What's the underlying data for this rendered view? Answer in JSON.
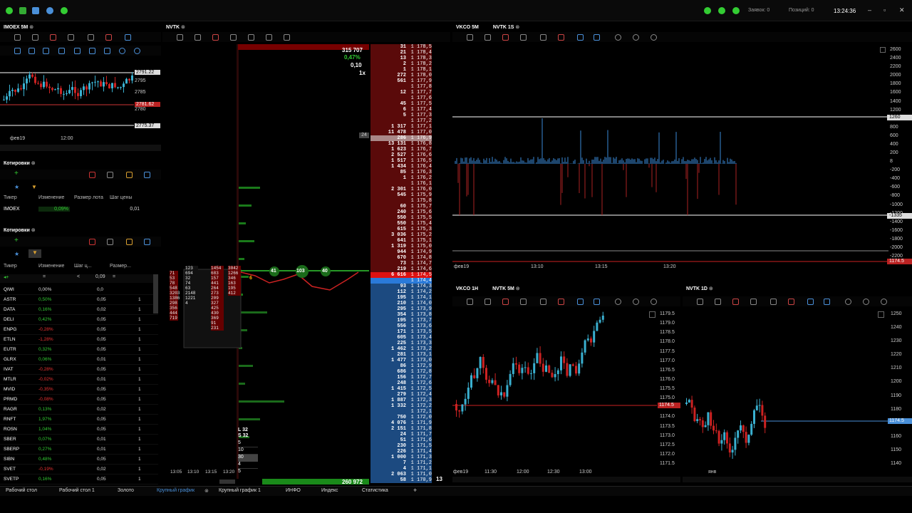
{
  "topbar": {
    "orders": "Заявок: 0",
    "positions": "Позиций: 0",
    "time": "13:24:36"
  },
  "imoex_chart": {
    "tab": "IMOEX 5M",
    "prices": [
      "2795",
      "2791.22",
      "2785",
      "2781.62",
      "2780",
      "2775.37"
    ],
    "xlabels": [
      "фев19",
      "12:00"
    ]
  },
  "quotes1": {
    "title": "Котировки",
    "headers": [
      "Тикер",
      "Изменение",
      "Размер лота",
      "Шаг цены"
    ],
    "row": {
      "ticker": "IMOEX",
      "change": "0,09%",
      "step": "0,01"
    }
  },
  "quotes2": {
    "title": "Котировки",
    "headers": [
      "Тикер",
      "Изменение",
      "Шаг ц...",
      "Размер..."
    ],
    "filter": {
      "change": "=",
      "step": "0,09",
      "lot": "="
    },
    "rows": [
      {
        "t": "QIWI",
        "c": "0,00%",
        "s": "0,0",
        "l": "",
        "col": "#ddd"
      },
      {
        "t": "ASTR",
        "c": "0,50%",
        "s": "0,05",
        "l": "1",
        "col": "#3c3"
      },
      {
        "t": "DATA",
        "c": "0,16%",
        "s": "0,02",
        "l": "1",
        "col": "#3c3"
      },
      {
        "t": "DELI",
        "c": "0,42%",
        "s": "0,05",
        "l": "1",
        "col": "#3c3"
      },
      {
        "t": "ENPG",
        "c": "-0,28%",
        "s": "0,05",
        "l": "1",
        "col": "#e33"
      },
      {
        "t": "ETLN",
        "c": "-1,28%",
        "s": "0,05",
        "l": "1",
        "col": "#e33"
      },
      {
        "t": "EUTR",
        "c": "0,32%",
        "s": "0,05",
        "l": "1",
        "col": "#3c3"
      },
      {
        "t": "GLRX",
        "c": "0,06%",
        "s": "0,01",
        "l": "1",
        "col": "#3c3"
      },
      {
        "t": "IVAT",
        "c": "-0,28%",
        "s": "0,05",
        "l": "1",
        "col": "#e33"
      },
      {
        "t": "MTLR",
        "c": "-0,02%",
        "s": "0,01",
        "l": "1",
        "col": "#e33"
      },
      {
        "t": "MVID",
        "c": "-0,35%",
        "s": "0,05",
        "l": "1",
        "col": "#e33"
      },
      {
        "t": "PRMD",
        "c": "-0,08%",
        "s": "0,05",
        "l": "1",
        "col": "#e33"
      },
      {
        "t": "RAGR",
        "c": "0,13%",
        "s": "0,02",
        "l": "1",
        "col": "#3c3"
      },
      {
        "t": "RNFT",
        "c": "1,97%",
        "s": "0,05",
        "l": "1",
        "col": "#3c3"
      },
      {
        "t": "ROSN",
        "c": "1,04%",
        "s": "0,05",
        "l": "1",
        "col": "#3c3"
      },
      {
        "t": "SBER",
        "c": "0,07%",
        "s": "0,01",
        "l": "1",
        "col": "#3c3"
      },
      {
        "t": "SBERP",
        "c": "0,27%",
        "s": "0,01",
        "l": "1",
        "col": "#3c3"
      },
      {
        "t": "SIBN",
        "c": "0,48%",
        "s": "0,05",
        "l": "1",
        "col": "#3c3"
      },
      {
        "t": "SVET",
        "c": "-0,19%",
        "s": "0,02",
        "l": "1",
        "col": "#e33"
      },
      {
        "t": "SVETP",
        "c": "0,16%",
        "s": "0,05",
        "l": "1",
        "col": "#3c3"
      }
    ]
  },
  "nvtk": {
    "tab": "NVTK",
    "vol_top": "315 707",
    "pct": "0,47%",
    "step": "0,10",
    "mult": "1x",
    "vol_bottom": "260 972",
    "bottom_num": "13",
    "side24": "24",
    "L": "L 32",
    "S": "S 32",
    "lots": [
      "5",
      "10",
      "30",
      "4",
      "5"
    ],
    "times": [
      "13:05",
      "13:10",
      "13:15",
      "13:20"
    ],
    "cluster": [
      "41",
      "103",
      "40"
    ],
    "cluster6": "6",
    "asks": [
      [
        "31",
        "1 178,5"
      ],
      [
        "21",
        "1 178,4"
      ],
      [
        "13",
        "1 178,3"
      ],
      [
        "2",
        "1 178,2"
      ],
      [
        "1",
        "1 178,1"
      ],
      [
        "272",
        "1 178,0"
      ],
      [
        "561",
        "1 177,9"
      ],
      [
        "",
        "1 177,8"
      ],
      [
        "12",
        "1 177,7"
      ],
      [
        "",
        "1 177,6"
      ],
      [
        "45",
        "1 177,5"
      ],
      [
        "6",
        "1 177,4"
      ],
      [
        "5",
        "1 177,3"
      ],
      [
        "",
        "1 177,2"
      ],
      [
        "1 317",
        "1 177,1"
      ],
      [
        "11 478",
        "1 177,0"
      ],
      [
        "286",
        "1 176,9"
      ],
      [
        "13 131",
        "1 176,8"
      ],
      [
        "1 623",
        "1 176,7"
      ],
      [
        "2 527",
        "1 176,6"
      ],
      [
        "1 517",
        "1 176,5"
      ],
      [
        "1 434",
        "1 176,4"
      ],
      [
        "85",
        "1 176,3"
      ],
      [
        "1",
        "1 176,2"
      ],
      [
        "",
        "1 176,1"
      ],
      [
        "2 301",
        "1 176,0"
      ],
      [
        "545",
        "1 175,9"
      ],
      [
        "",
        "1 175,8"
      ],
      [
        "60",
        "1 175,7"
      ],
      [
        "240",
        "1 175,6"
      ],
      [
        "550",
        "1 175,5"
      ],
      [
        "550",
        "1 175,4"
      ],
      [
        "615",
        "1 175,3"
      ],
      [
        "3 036",
        "1 175,2"
      ],
      [
        "641",
        "1 175,1"
      ],
      [
        "1 319",
        "1 175,0"
      ],
      [
        "944",
        "1 174,9"
      ],
      [
        "670",
        "1 174,8"
      ],
      [
        "73",
        "1 174,7"
      ],
      [
        "219",
        "1 174,6"
      ],
      [
        "6 616",
        "1 174,5"
      ]
    ],
    "bids": [
      [
        "",
        "1 174,4"
      ],
      [
        "93",
        "1 174,3"
      ],
      [
        "112",
        "1 174,2"
      ],
      [
        "195",
        "1 174,1"
      ],
      [
        "210",
        "1 174,0"
      ],
      [
        "295",
        "1 173,9"
      ],
      [
        "354",
        "1 173,8"
      ],
      [
        "195",
        "1 173,7"
      ],
      [
        "556",
        "1 173,6"
      ],
      [
        "171",
        "1 173,5"
      ],
      [
        "605",
        "1 173,4"
      ],
      [
        "225",
        "1 173,3"
      ],
      [
        "1 462",
        "1 173,2"
      ],
      [
        "281",
        "1 173,1"
      ],
      [
        "1 477",
        "1 173,0"
      ],
      [
        "86",
        "1 172,9"
      ],
      [
        "686",
        "1 172,8"
      ],
      [
        "156",
        "1 172,7"
      ],
      [
        "248",
        "1 172,6"
      ],
      [
        "1 415",
        "1 172,5"
      ],
      [
        "279",
        "1 172,4"
      ],
      [
        "1 887",
        "1 172,3"
      ],
      [
        "1 332",
        "1 172,2"
      ],
      [
        "",
        "1 172,1"
      ],
      [
        "750",
        "1 172,0"
      ],
      [
        "4 076",
        "1 171,9"
      ],
      [
        "2 151",
        "1 171,8"
      ],
      [
        "24",
        "1 171,7"
      ],
      [
        "51",
        "1 171,6"
      ],
      [
        "230",
        "1 171,5"
      ],
      [
        "226",
        "1 171,4"
      ],
      [
        "1 000",
        "1 171,3"
      ],
      [
        "7",
        "1 171,2"
      ],
      [
        "4",
        "1 171,1"
      ],
      [
        "2 063",
        "1 171,0"
      ],
      [
        "58",
        "1 170,9"
      ]
    ]
  },
  "vkco5m": {
    "tab1": "VKCO 5M",
    "tab2": "NVTK 1S",
    "yaxis": [
      "2600",
      "2400",
      "2200",
      "2000",
      "1800",
      "1600",
      "1400",
      "1200",
      "1000",
      "800",
      "600",
      "400",
      "200",
      "8",
      "-200",
      "-400",
      "-600",
      "-800",
      "-1000",
      "-1200",
      "-1400",
      "-1600",
      "-1800",
      "-2000",
      "-2200"
    ],
    "hl_top": "1260",
    "hl_bot": "-1335",
    "price": "1174.5",
    "xlabels": [
      "фев19",
      "13:10",
      "13:15",
      "13:20"
    ]
  },
  "vkco1h": {
    "tab1": "VKCO 1H",
    "tab2": "NVTK 5M",
    "yaxis": [
      "1179.5",
      "1179.0",
      "1178.5",
      "1178.0",
      "1177.5",
      "1177.0",
      "1176.5",
      "1176.0",
      "1175.5",
      "1175.0",
      "1174.5",
      "1174.0",
      "1173.5",
      "1173.0",
      "1172.5",
      "1172.0",
      "1171.5"
    ],
    "price": "1174.5",
    "xlabels": [
      "фев19",
      "11:30",
      "12:00",
      "12:30",
      "13:00"
    ]
  },
  "nvtk1d": {
    "tab": "NVTK 1D",
    "yaxis": [
      "1250",
      "1240",
      "1230",
      "1220",
      "1210",
      "1200",
      "1190",
      "1180",
      "1170",
      "1160",
      "1150",
      "1140"
    ],
    "price": "1174.5",
    "xlabels": [
      "янв"
    ]
  },
  "bottom": {
    "tabs": [
      "Рабочий стол",
      "Рабочий стол 1",
      "Золото",
      "Крупный график",
      "Крупный график 1",
      "ИНФО",
      "Индекс",
      "Статистика"
    ],
    "add": "+"
  }
}
